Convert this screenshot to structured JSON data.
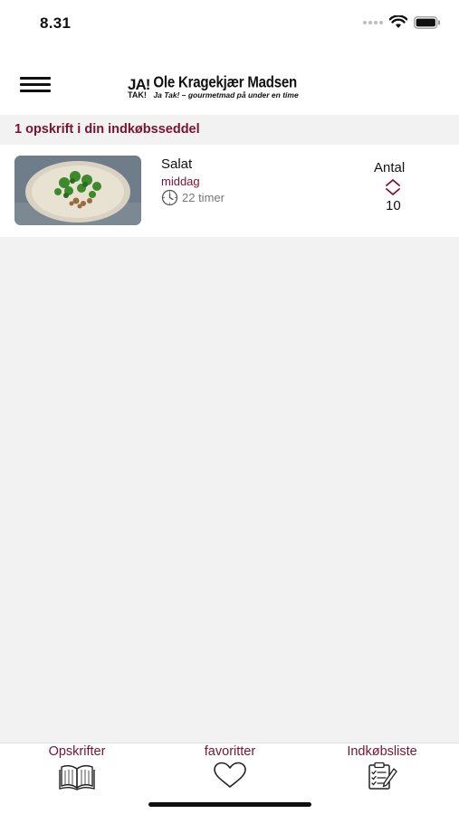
{
  "status_bar": {
    "time": "8.31"
  },
  "header": {
    "logo_ja": "JA!",
    "logo_tak": "TAK!",
    "logo_name": "Ole Kragekjær Madsen",
    "logo_tagline": "Ja Tak! – gourmetmad på under en time"
  },
  "shopping_list": {
    "summary": "1 opskrift i din indkøbsseddel",
    "items": [
      {
        "title": "Salat",
        "category": "middag",
        "time": "22 timer",
        "quantity_label": "Antal",
        "quantity": "10"
      }
    ]
  },
  "tabs": [
    {
      "label": "Opskrifter",
      "icon": "book-icon"
    },
    {
      "label": "favoritter",
      "icon": "heart-icon"
    },
    {
      "label": "Indkøbsliste",
      "icon": "checklist-icon"
    }
  ],
  "colors": {
    "accent": "#7a1230",
    "background": "#f2f2f2"
  }
}
